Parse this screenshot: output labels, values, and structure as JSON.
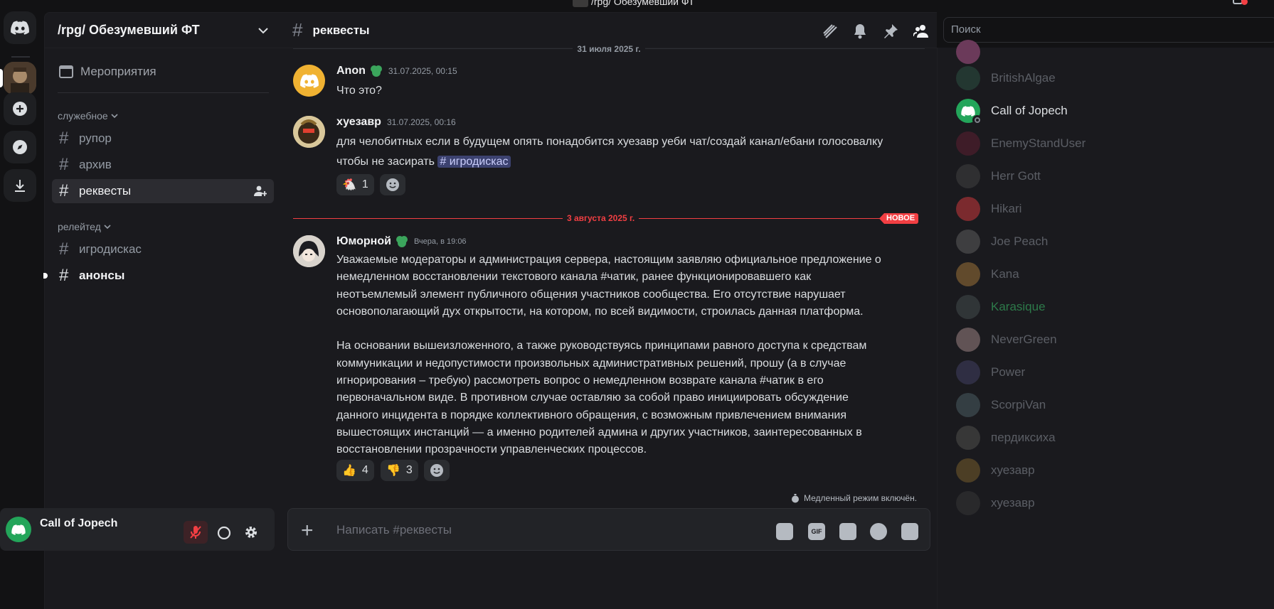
{
  "window": {
    "title": "/rpg/ Обезумевший ФТ"
  },
  "guild": {
    "name": "/rpg/ Обезумевший ФТ"
  },
  "sidebar": {
    "events_label": "Мероприятия",
    "categories": [
      {
        "name": "служебное"
      },
      {
        "name": "релейтед"
      }
    ],
    "channels": [
      {
        "name": "рупор"
      },
      {
        "name": "архив"
      },
      {
        "name": "реквесты"
      },
      {
        "name": "игродискас"
      },
      {
        "name": "анонсы"
      }
    ]
  },
  "user_panel": {
    "username": "Call of Jopech"
  },
  "channel_header": {
    "name": "реквесты"
  },
  "search": {
    "placeholder": "Поиск"
  },
  "chat": {
    "date_top": "31 июля 2025 г.",
    "messages": [
      {
        "author": "Anon",
        "time": "31.07.2025, 00:15",
        "text": "Что это?"
      },
      {
        "author": "хуезавр",
        "time": "31.07.2025, 00:16",
        "text": "для челобитных если в будущем опять понадобится хуезавр уеби чат/создай канал/ебани голосовалку",
        "text2": "чтобы не засирать",
        "mention": "# игродискас",
        "reactions": [
          {
            "emoji": "🐔",
            "count": "1"
          }
        ]
      },
      {
        "author": "Юморной",
        "time": "Вчера, в 19:06",
        "paragraph1": [
          "Уважаемые модераторы и администрация сервера, настоящим заявляю официальное предложение о",
          "немедленном восстановлении текстового канала #чатик, ранее функционировавшего как",
          "неотъемлемый элемент публичного общения участников сообщества. Его отсутствие нарушает",
          "основополагающий дух открытости, на котором, по всей видимости, строилась данная платформа."
        ],
        "paragraph2": [
          "На основании вышеизложенного, а также руководствуясь принципами равного доступа к средствам",
          "коммуникации и недопустимости произвольных административных решений, прошу (а в случае",
          "игнорирования – требую) рассмотреть вопрос о немедленном возврате канала #чатик в его",
          "первоначальном виде. В противном случае оставляю за собой право инициировать обсуждение",
          "данного инцидента в порядке коллективного обращения, с возможным привлечением внимания",
          "вышестоящих инстанций — а именно родителей админа и других участников, заинтересованных в",
          "восстановлении прозрачности управленческих процессов."
        ],
        "reactions": [
          {
            "emoji": "👍",
            "count": "4"
          },
          {
            "emoji": "👎",
            "count": "3"
          }
        ]
      }
    ],
    "new_divider": {
      "date": "3 августа 2025 г.",
      "badge": "НОВОЕ"
    },
    "slowmode": "Медленный режим включён."
  },
  "composer": {
    "placeholder": "Написать #реквесты",
    "gif_label": "GIF"
  },
  "members": [
    {
      "name": "BritishAlgae",
      "online": false,
      "color": "#2f5b4a"
    },
    {
      "name": "Call of Jopech",
      "online": true,
      "color": "#23a55a"
    },
    {
      "name": "EnemyStandUser",
      "online": false,
      "color": "#6b2035"
    },
    {
      "name": "Herr Gott",
      "online": false,
      "color": "#4a4a4a"
    },
    {
      "name": "Hikari",
      "online": false,
      "color": "#f23f43"
    },
    {
      "name": "Joe Peach",
      "online": false,
      "color": "#6a6a6a"
    },
    {
      "name": "Kana",
      "online": false,
      "color": "#b8863e"
    },
    {
      "name": "Karasique",
      "online": false,
      "color": "#4c5656",
      "name_color": "#2d7a4a"
    },
    {
      "name": "NeverGreen",
      "online": false,
      "color": "#b89a9a"
    },
    {
      "name": "Power",
      "online": false,
      "color": "#4a4670"
    },
    {
      "name": "ScorpiVan",
      "online": false,
      "color": "#556a72"
    },
    {
      "name": "пердиксиха",
      "online": false,
      "color": "#5a5a56"
    },
    {
      "name": "хуезавр",
      "online": false,
      "color": "#8a6a2e"
    },
    {
      "name": "хуезавр",
      "online": false,
      "color": "#3c3c3c"
    }
  ]
}
